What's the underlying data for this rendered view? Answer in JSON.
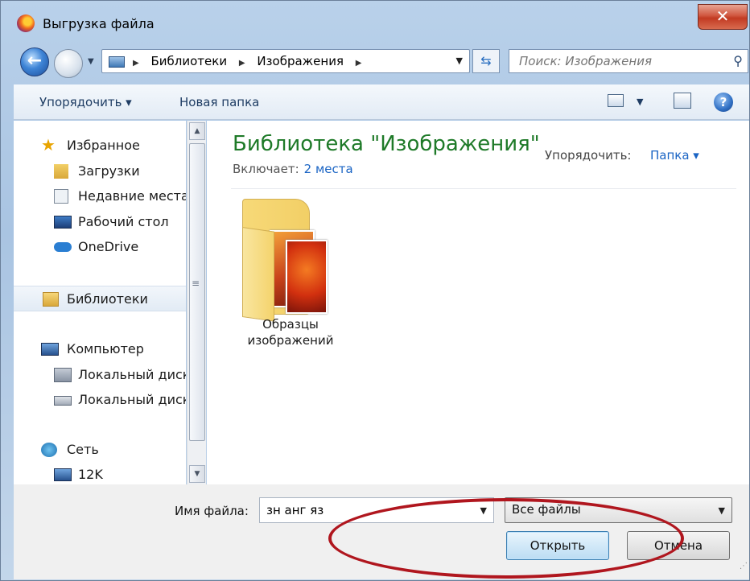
{
  "window": {
    "title": "Выгрузка файла",
    "close_label": "✕"
  },
  "address": {
    "crumbs": [
      "Библиотеки",
      "Изображения"
    ],
    "search_placeholder": "Поиск: Изображения"
  },
  "toolbar": {
    "organize_label": "Упорядочить ▾",
    "new_folder_label": "Новая папка"
  },
  "sidebar": {
    "items": [
      {
        "label": "Избранное",
        "icon": "star-icon"
      },
      {
        "label": "Загрузки",
        "icon": "downloads-icon"
      },
      {
        "label": "Недавние места",
        "icon": "recent-places-icon"
      },
      {
        "label": "Рабочий стол",
        "icon": "desktop-icon"
      },
      {
        "label": "OneDrive",
        "icon": "cloud-icon"
      },
      {
        "label": "Библиотеки",
        "icon": "libraries-icon"
      },
      {
        "label": "Компьютер",
        "icon": "computer-icon"
      },
      {
        "label": "Локальный диск",
        "icon": "drive-icon"
      },
      {
        "label": "Локальный диск",
        "icon": "drive-icon"
      },
      {
        "label": "Сеть",
        "icon": "network-icon"
      },
      {
        "label": "12K",
        "icon": "network-computer-icon"
      }
    ]
  },
  "library": {
    "title": "Библиотека \"Изображения\"",
    "includes_label": "Включает:",
    "includes_link": "2 места",
    "arrange_label": "Упорядочить:",
    "arrange_value": "Папка ▾",
    "folder_label": "Образцы изображений"
  },
  "bottom": {
    "filename_label": "Имя файла:",
    "filename_value": "зн анг яз",
    "filetype_value": "Все файлы",
    "open_label": "Открыть",
    "cancel_label": "Отмена"
  },
  "colors": {
    "library_title": "#1e7a28",
    "link": "#1a64c4",
    "annotation": "#b0161e"
  }
}
